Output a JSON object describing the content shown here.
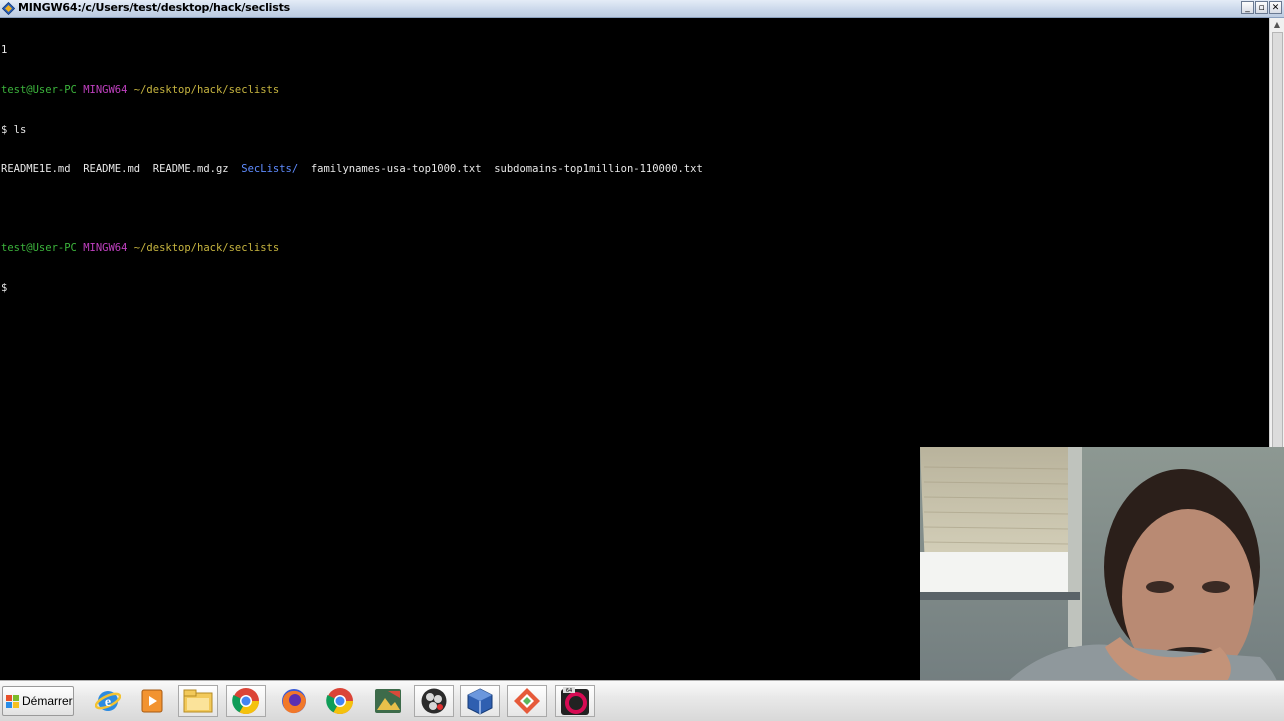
{
  "window": {
    "title": "MINGW64:/c/Users/test/desktop/hack/seclists",
    "minimize": "_",
    "maximize": "▫",
    "close": "✕"
  },
  "terminal": {
    "line0": "1",
    "prompt1": {
      "user": "test@User-PC",
      "system": "MINGW64",
      "path": "~/desktop/hack/seclists"
    },
    "command1": "$ ls",
    "ls_output": {
      "file1": "README1E.md",
      "file2": "README.md",
      "file3": "README.md.gz",
      "dir1": "SecLists/",
      "file4": "familynames-usa-top1000.txt",
      "file5": "subdomains-top1million-110000.txt"
    },
    "prompt2": {
      "user": "test@User-PC",
      "system": "MINGW64",
      "path": "~/desktop/hack/seclists"
    },
    "command2": "$",
    "colors": {
      "user": "#3cb43c",
      "system": "#c040c0",
      "path": "#c8b640",
      "dir": "#5f8cff"
    }
  },
  "taskbar": {
    "start_label": "Démarrer",
    "icons": [
      "internet-explorer-icon",
      "media-player-icon",
      "file-explorer-icon",
      "chrome-icon",
      "firefox-icon",
      "chrome-icon",
      "image-viewer-icon",
      "obs-icon",
      "virtualbox-icon",
      "git-icon",
      "debian-terminal-icon"
    ]
  },
  "webcam": {
    "content": "webcam-overlay"
  }
}
